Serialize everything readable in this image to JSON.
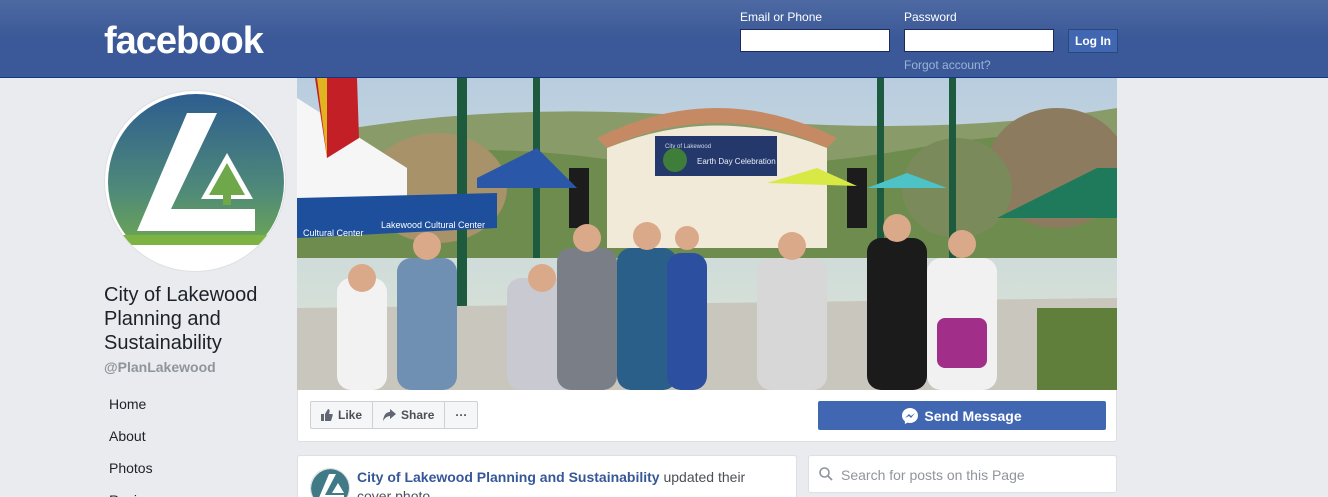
{
  "header": {
    "logo_text": "facebook",
    "email_label": "Email or Phone",
    "password_label": "Password",
    "login_button": "Log In",
    "forgot_link": "Forgot account?"
  },
  "page": {
    "name": "City of Lakewood Planning and Sustainability",
    "handle": "@PlanLakewood"
  },
  "side_nav": {
    "items": [
      {
        "label": "Home"
      },
      {
        "label": "About"
      },
      {
        "label": "Photos"
      },
      {
        "label": "Reviews"
      }
    ]
  },
  "cover": {
    "banner_small": "City of Lakewood",
    "banner_text": "Earth Day Celebration",
    "tent_text_left": "Cultural Center",
    "tent_text_right": "Lakewood Cultural Center"
  },
  "actions": {
    "like_label": "Like",
    "share_label": "Share",
    "more_label": "···",
    "send_message_label": "Send Message"
  },
  "post": {
    "author": "City of Lakewood Planning and Sustainability",
    "action_text": "updated their cover photo."
  },
  "search": {
    "placeholder": "Search for posts on this Page"
  },
  "colors": {
    "brand_blue": "#3b5998",
    "button_blue": "#4267b2",
    "link_blue": "#365899",
    "page_bg": "#e9ebee"
  }
}
